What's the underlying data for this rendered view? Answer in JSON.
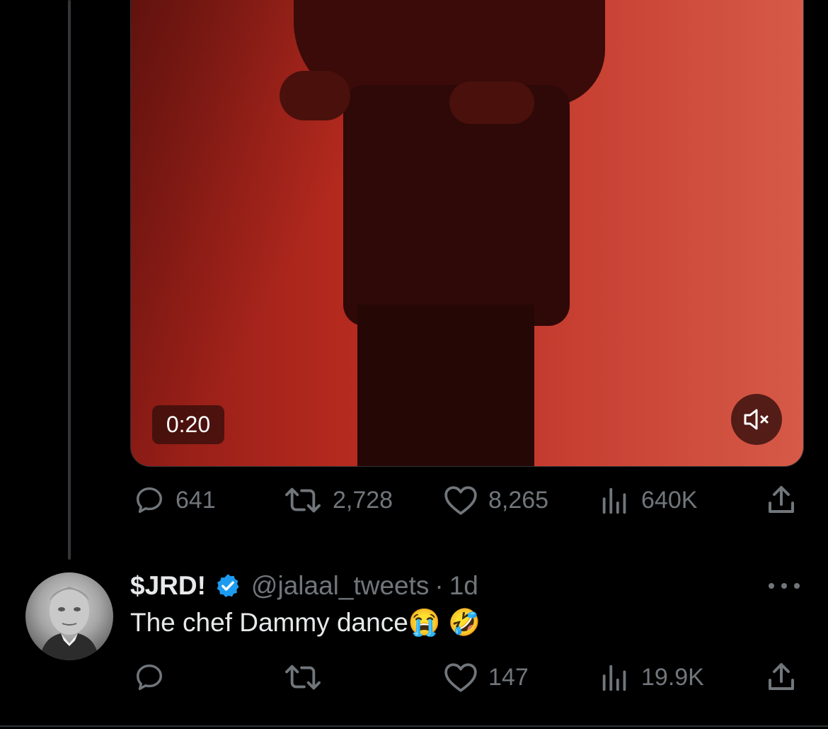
{
  "video": {
    "duration": "0:20",
    "mute_icon": "speaker-muted-icon"
  },
  "main_tweet": {
    "actions": {
      "replies": "641",
      "retweets": "2,728",
      "likes": "8,265",
      "views": "640K"
    }
  },
  "reply": {
    "display_name": "$JRD!",
    "handle": "@jalaal_tweets",
    "separator": "·",
    "time": "1d",
    "text": "The chef Dammy dance😭 🤣",
    "verified": true,
    "actions": {
      "replies": "",
      "retweets": "",
      "likes": "147",
      "views": "19.9K"
    }
  },
  "colors": {
    "background": "#000000",
    "text": "#e7e9ea",
    "muted": "#71767b",
    "verified": "#1d9bf0"
  }
}
